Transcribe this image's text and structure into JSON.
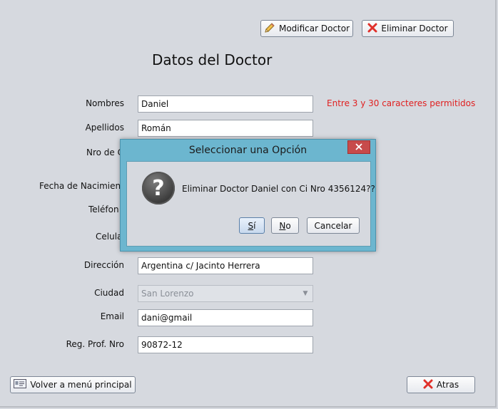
{
  "toolbar": {
    "modify_label": "Modificar Doctor",
    "delete_label": "Eliminar Doctor"
  },
  "page_title": "Datos del Doctor",
  "form": {
    "nombres": {
      "label": "Nombres",
      "value": "Daniel",
      "hint": "Entre 3 y 30 caracteres permitidos"
    },
    "apellidos": {
      "label": "Apellidos",
      "value": "Román"
    },
    "nro_ci": {
      "label": "Nro de C"
    },
    "fecha_nacimiento": {
      "label": "Fecha de Nacimient"
    },
    "telefono": {
      "label": "Teléfon"
    },
    "celular": {
      "label": "Celula"
    },
    "direccion": {
      "label": "Dirección",
      "value": "Argentina c/ Jacinto Herrera"
    },
    "ciudad": {
      "label": "Ciudad",
      "value": "San Lorenzo"
    },
    "email": {
      "label": "Email",
      "value": "dani@gmail"
    },
    "reg_prof": {
      "label": "Reg. Prof. Nro",
      "value": "90872-12"
    }
  },
  "footer": {
    "back_menu_label": "Volver a menú principal",
    "back_label": "Atras"
  },
  "dialog": {
    "title": "Seleccionar una Opción",
    "message": "Eliminar Doctor Daniel con Ci Nro 4356124??",
    "yes_first": "S",
    "yes_rest": "í",
    "no_first": "N",
    "no_rest": "o",
    "cancel_label": "Cancelar"
  },
  "colors": {
    "window_bg": "#d6d9df",
    "error_text": "#e02020",
    "dialog_frame": "#6cb6cf",
    "close_button": "#c74b4b"
  }
}
